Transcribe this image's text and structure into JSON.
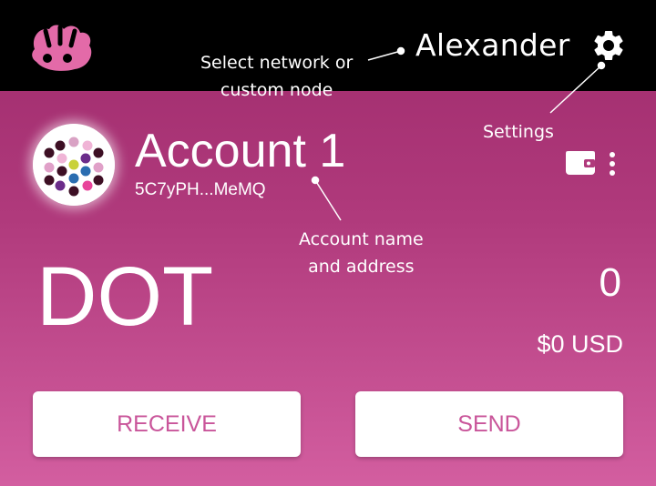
{
  "header": {
    "network_label": "Alexander",
    "logo_icon": "polkadot-logo-icon",
    "settings_icon": "gear-icon"
  },
  "annotations": {
    "network_line1": "Select network or",
    "network_line2": "custom node",
    "settings": "Settings",
    "account_line1": "Account name",
    "account_line2": "and address"
  },
  "account": {
    "name": "Account 1",
    "address": "5C7yPH...MeMQ",
    "avatar_icon": "identicon-icon"
  },
  "balance": {
    "token": "DOT",
    "amount": "0",
    "fiat": "$0 USD"
  },
  "actions": {
    "receive_label": "RECEIVE",
    "send_label": "SEND"
  },
  "colors": {
    "brand": "#e6007a",
    "button_text": "#c9559a",
    "topbar": "#000000"
  }
}
